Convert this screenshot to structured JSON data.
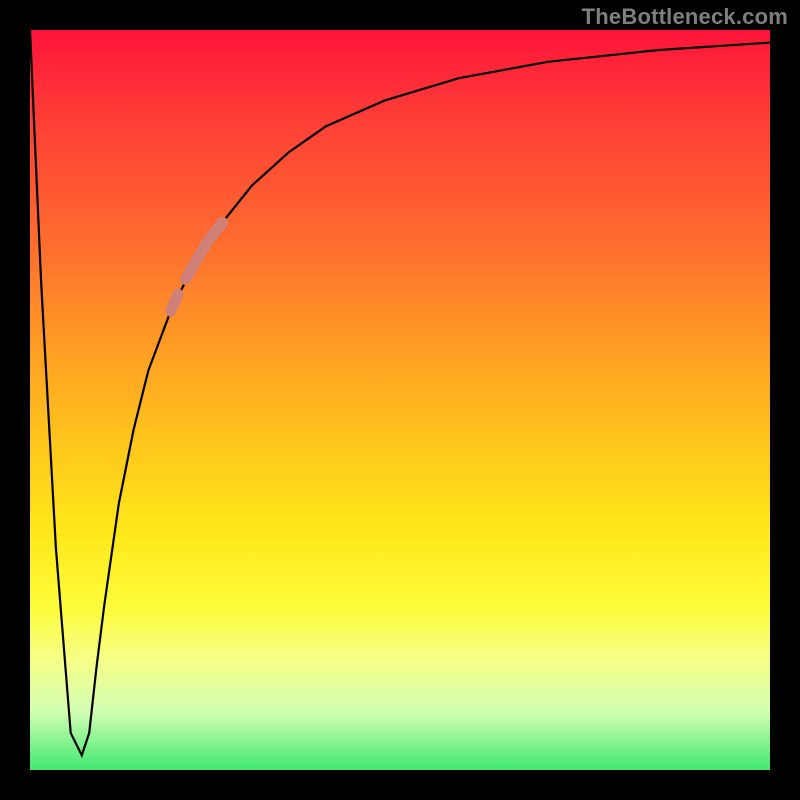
{
  "watermark": "TheBottleneck.com",
  "colors": {
    "background": "#000000",
    "curve": "#000000",
    "highlight": "#cf8079",
    "watermark": "#7f7f7f",
    "gradient_top": "#ff143a",
    "gradient_bottom": "#40e872"
  },
  "chart_data": {
    "type": "line",
    "title": "",
    "xlabel": "",
    "ylabel": "",
    "xlim": [
      0,
      100
    ],
    "ylim": [
      0,
      100
    ],
    "grid": false,
    "legend": false,
    "series": [
      {
        "name": "bottleneck-curve",
        "x": [
          0,
          1.5,
          3.5,
          5.5,
          7,
          8,
          9,
          10,
          12,
          14,
          16,
          19,
          22,
          26,
          30,
          35,
          40,
          48,
          58,
          70,
          85,
          100
        ],
        "y": [
          100,
          66,
          30,
          5,
          2,
          5,
          14,
          22,
          36,
          46,
          54,
          62,
          68,
          74,
          79,
          83.5,
          87,
          90.5,
          93.5,
          95.7,
          97.3,
          98.3
        ]
      },
      {
        "name": "highlight-segment",
        "x": [
          19,
          20,
          21,
          22,
          23,
          24,
          25,
          26
        ],
        "y": [
          62,
          64.3,
          66.3,
          68,
          69.8,
          71.4,
          72.7,
          74
        ]
      }
    ]
  }
}
